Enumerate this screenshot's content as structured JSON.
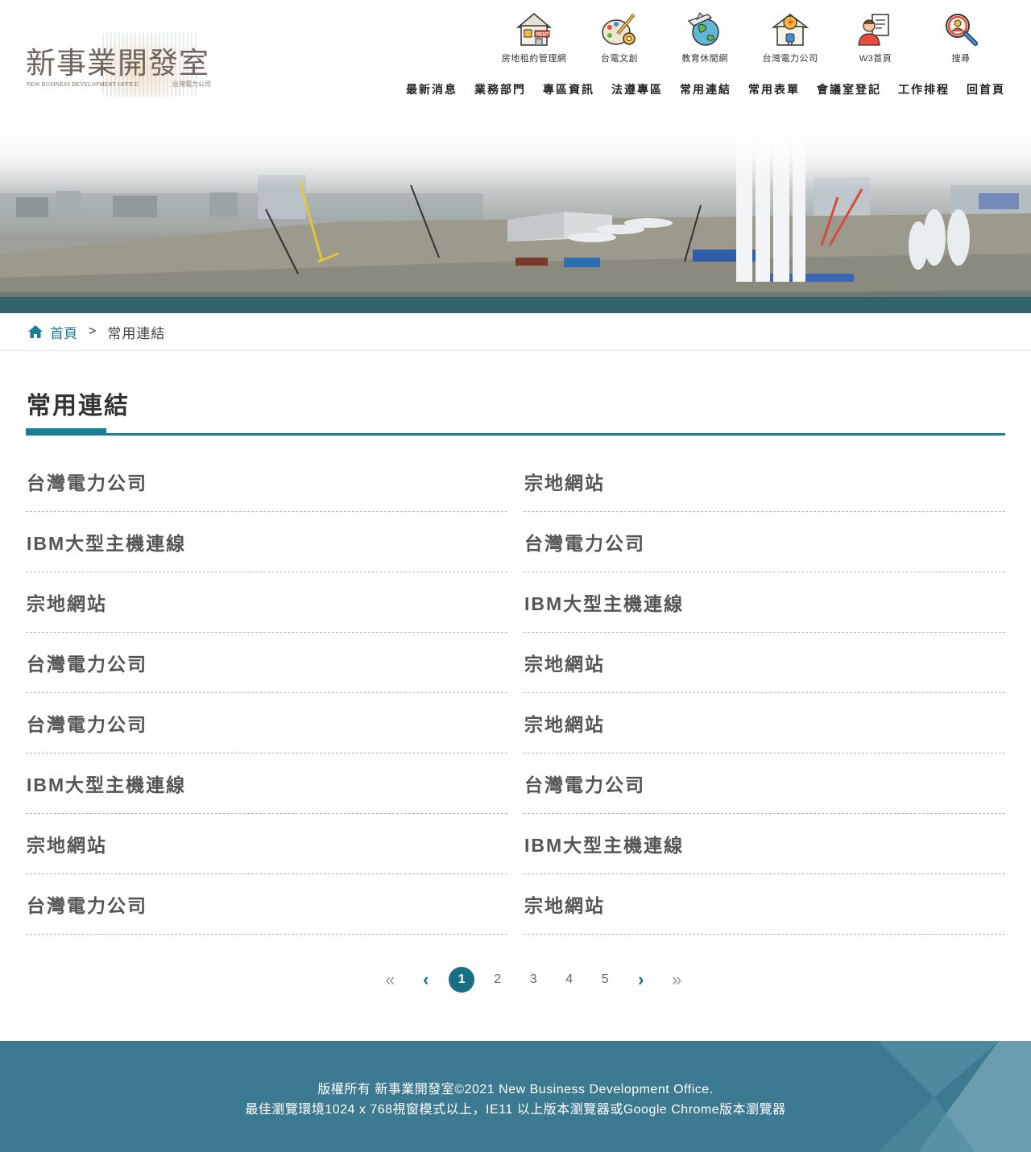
{
  "site": {
    "logo_title": "新事業開發室",
    "logo_subtitle_en": "NEW BUSINESS DEVELOPMENT OFFICE",
    "logo_subtitle_zh": "台灣電力公司"
  },
  "quick_links": [
    {
      "label": "房地租約管理網",
      "icon": "rent-house-icon"
    },
    {
      "label": "台電文創",
      "icon": "creative-palette-icon"
    },
    {
      "label": "教育休閒網",
      "icon": "globe-airplane-icon"
    },
    {
      "label": "台灣電力公司",
      "icon": "power-house-icon"
    },
    {
      "label": "W3首頁",
      "icon": "staff-document-icon"
    },
    {
      "label": "搜尋",
      "icon": "search-person-icon"
    }
  ],
  "main_nav": [
    "最新消息",
    "業務部門",
    "專區資訊",
    "法遵專區",
    "常用連結",
    "常用表單",
    "會議室登記",
    "工作排程",
    "回首頁"
  ],
  "breadcrumb": {
    "home": "首頁",
    "separator": ">",
    "current": "常用連結"
  },
  "page_title": "常用連結",
  "links": [
    "台灣電力公司",
    "宗地網站",
    "IBM大型主機連線",
    "台灣電力公司",
    "宗地網站",
    "IBM大型主機連線",
    "台灣電力公司",
    "宗地網站",
    "台灣電力公司",
    "宗地網站",
    "IBM大型主機連線",
    "台灣電力公司",
    "宗地網站",
    "IBM大型主機連線",
    "台灣電力公司",
    "宗地網站"
  ],
  "pagination": {
    "first": "«",
    "prev": "‹",
    "pages": [
      "1",
      "2",
      "3",
      "4",
      "5"
    ],
    "current": "1",
    "next": "›",
    "last": "»"
  },
  "footer": {
    "line1": "版權所有 新事業開發室©2021 New Business Development Office.",
    "line2": "最佳瀏覽環境1024 x 768視窗模式以上，IE11 以上版本瀏覽器或Google Chrome版本瀏覽器"
  },
  "colors": {
    "accent": "#1a7f94",
    "footer_bg": "#3c7a91",
    "page_active": "#186f84"
  }
}
